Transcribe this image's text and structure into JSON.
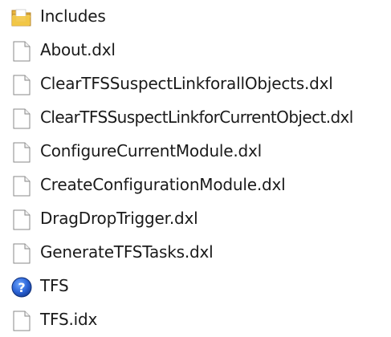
{
  "file_list": {
    "items": [
      {
        "name": "Includes",
        "icon": "folder-icon"
      },
      {
        "name": "About.dxl",
        "icon": "document-icon"
      },
      {
        "name": "ClearTFSSuspectLinkforallObjects.dxl",
        "icon": "document-icon"
      },
      {
        "name": "ClearTFSSuspectLinkforCurrentObject.dxl",
        "icon": "document-icon"
      },
      {
        "name": "ConfigureCurrentModule.dxl",
        "icon": "document-icon"
      },
      {
        "name": "CreateConfigurationModule.dxl",
        "icon": "document-icon"
      },
      {
        "name": "DragDropTrigger.dxl",
        "icon": "document-icon"
      },
      {
        "name": "GenerateTFSTasks.dxl",
        "icon": "document-icon"
      },
      {
        "name": "TFS",
        "icon": "help-icon"
      },
      {
        "name": "TFS.idx",
        "icon": "document-icon"
      }
    ]
  }
}
